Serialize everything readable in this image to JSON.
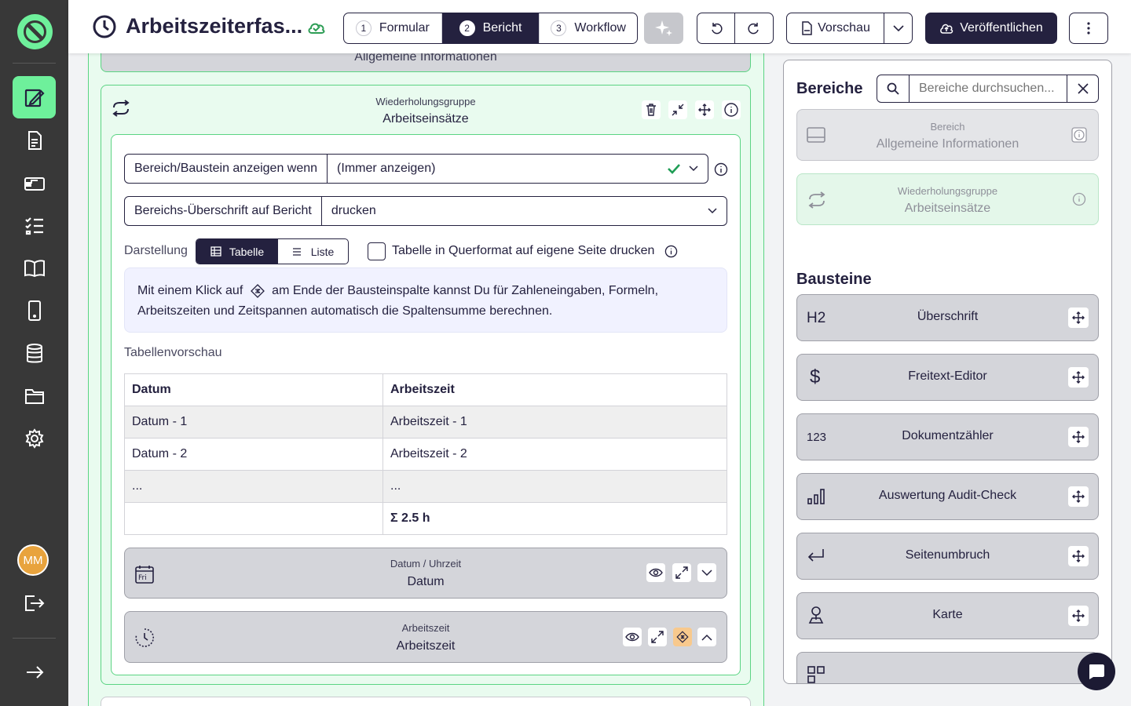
{
  "app": {
    "title": "Arbeitszeiterfas...",
    "user_initials": "MM"
  },
  "steps": [
    {
      "num": "1",
      "label": "Formular"
    },
    {
      "num": "2",
      "label": "Bericht"
    },
    {
      "num": "3",
      "label": "Workflow"
    }
  ],
  "toolbar": {
    "preview_label": "Vorschau",
    "publish_label": "Veröffentlichen"
  },
  "section_above": {
    "title": "Allgemeine Informationen"
  },
  "repeat_group": {
    "type": "Wiederholungsgruppe",
    "title": "Arbeitseinsätze"
  },
  "condition": {
    "label": "Bereich/Baustein anzeigen wenn",
    "value": "(Immer anzeigen)"
  },
  "heading_print": {
    "label": "Bereichs-Überschrift auf Bericht",
    "value": "drucken"
  },
  "display": {
    "label": "Darstellung",
    "options": [
      "Tabelle",
      "Liste"
    ],
    "selected": "Tabelle",
    "landscape_label": "Tabelle in Querformat auf eigene Seite drucken",
    "landscape_checked": false
  },
  "hint": {
    "before": "Mit einem Klick auf",
    "after": "am Ende der Bausteinspalte kannst Du für Zahleneingaben, Formeln, Arbeitszeiten und Zeitspannen automatisch die Spaltensumme berechnen."
  },
  "table_preview": {
    "label": "Tabellenvorschau",
    "headers": [
      "Datum",
      "Arbeitszeit"
    ],
    "rows": [
      [
        "Datum - 1",
        "Arbeitszeit - 1"
      ],
      [
        "Datum - 2",
        "Arbeitszeit - 2"
      ],
      [
        "...",
        "..."
      ],
      [
        "",
        "Σ 2.5 h"
      ]
    ]
  },
  "fields": [
    {
      "type": "Datum / Uhrzeit",
      "title": "Datum",
      "icon_text": "Fri"
    },
    {
      "type": "Arbeitszeit",
      "title": "Arbeitszeit"
    }
  ],
  "sidebar": {
    "sections_title": "Bereiche",
    "search_placeholder": "Bereiche durchsuchen...",
    "sections": [
      {
        "type": "Bereich",
        "title": "Allgemeine Informationen"
      },
      {
        "type": "Wiederholungsgruppe",
        "title": "Arbeitseinsätze"
      }
    ],
    "blocks_title": "Bausteine",
    "blocks": [
      {
        "label": "Überschrift",
        "icon_text": "H2"
      },
      {
        "label": "Freitext-Editor",
        "icon_text": "$"
      },
      {
        "label": "Dokumentzähler",
        "icon_text": "123"
      },
      {
        "label": "Auswertung Audit-Check"
      },
      {
        "label": "Seitenumbruch"
      },
      {
        "label": "Karte"
      }
    ]
  },
  "colors": {
    "accent": "#6ef09b",
    "dark": "#24213f",
    "rail": "#383838"
  }
}
